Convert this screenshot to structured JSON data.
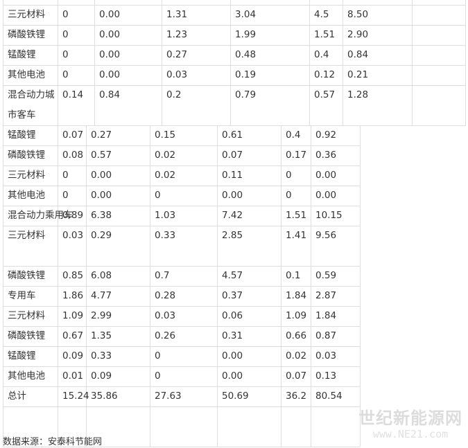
{
  "table": {
    "groups": [
      {
        "rows": [
          {
            "cells": [
              "三元材料",
              "0",
              "0.00",
              "1.31",
              "3.04",
              "4.5",
              "8.50"
            ]
          },
          {
            "cells": [
              "磷酸铁锂",
              "0",
              "0.00",
              "1.23",
              "1.99",
              "1.51",
              "2.90"
            ]
          },
          {
            "cells": [
              "锰酸锂",
              "0",
              "0.00",
              "0.27",
              "0.48",
              "0.4",
              "0.84"
            ]
          },
          {
            "cells": [
              "其他电池",
              "0",
              "0.00",
              "0.03",
              "0.19",
              "0.12",
              "0.21"
            ]
          },
          {
            "cells": [
              "混合动力城市客车",
              "0.14",
              "0.84",
              "0.2",
              "0.79",
              "0.57",
              "1.28"
            ]
          }
        ]
      },
      {
        "rows": [
          {
            "cells": [
              "锰酸锂",
              "0.07",
              "0.27",
              "0.15",
              "0.61",
              "0.4",
              "0.92"
            ]
          },
          {
            "cells": [
              "磷酸铁锂",
              "0.08",
              "0.57",
              "0.02",
              "0.07",
              "0.17",
              "0.36"
            ]
          },
          {
            "cells": [
              "三元材料",
              "0",
              "0.00",
              "0.02",
              "0.11",
              "0",
              "0.00"
            ]
          },
          {
            "cells": [
              "其他电池",
              "0",
              "0.00",
              "0",
              "0.00",
              "0",
              "0.00"
            ]
          },
          {
            "cells": [
              "混合动力乘用车",
              "0.89",
              "6.38",
              "1.03",
              "7.42",
              "1.51",
              "10.15"
            ]
          },
          {
            "cells": [
              "三元材料",
              "0.03",
              "0.29",
              "0.33",
              "2.85",
              "1.41",
              "9.56"
            ]
          },
          {
            "cells": [
              "磷酸铁锂",
              "0.85",
              "6.08",
              "0.7",
              "4.57",
              "0.1",
              "0.59"
            ]
          },
          {
            "cells": [
              "专用车",
              "1.86",
              "4.77",
              "0.28",
              "0.37",
              "1.84",
              "2.87"
            ]
          },
          {
            "cells": [
              "三元材料",
              "1.09",
              "2.99",
              "0.03",
              "0.06",
              "1.09",
              "1.84"
            ]
          },
          {
            "cells": [
              "磷酸铁锂",
              "0.67",
              "1.35",
              "0.26",
              "0.31",
              "0.66",
              "0.87"
            ]
          },
          {
            "cells": [
              "锰酸锂",
              "0.09",
              "0.33",
              "0",
              "0.00",
              "0.02",
              "0.03"
            ]
          },
          {
            "cells": [
              "其他电池",
              "0.01",
              "0.09",
              "0",
              "0.00",
              "0.07",
              "0.13"
            ]
          },
          {
            "cells": [
              "总计",
              "15.24",
              "35.86",
              "27.63",
              "50.69",
              "36.2",
              "80.54"
            ]
          }
        ]
      }
    ]
  },
  "source_note": "数据来源：安泰科节能网",
  "watermark": {
    "title": "世纪新能源网",
    "url": "www.NE21.com"
  },
  "colors": {
    "border": "#dedede",
    "text": "#333333",
    "watermark": "#dcdcdc"
  }
}
